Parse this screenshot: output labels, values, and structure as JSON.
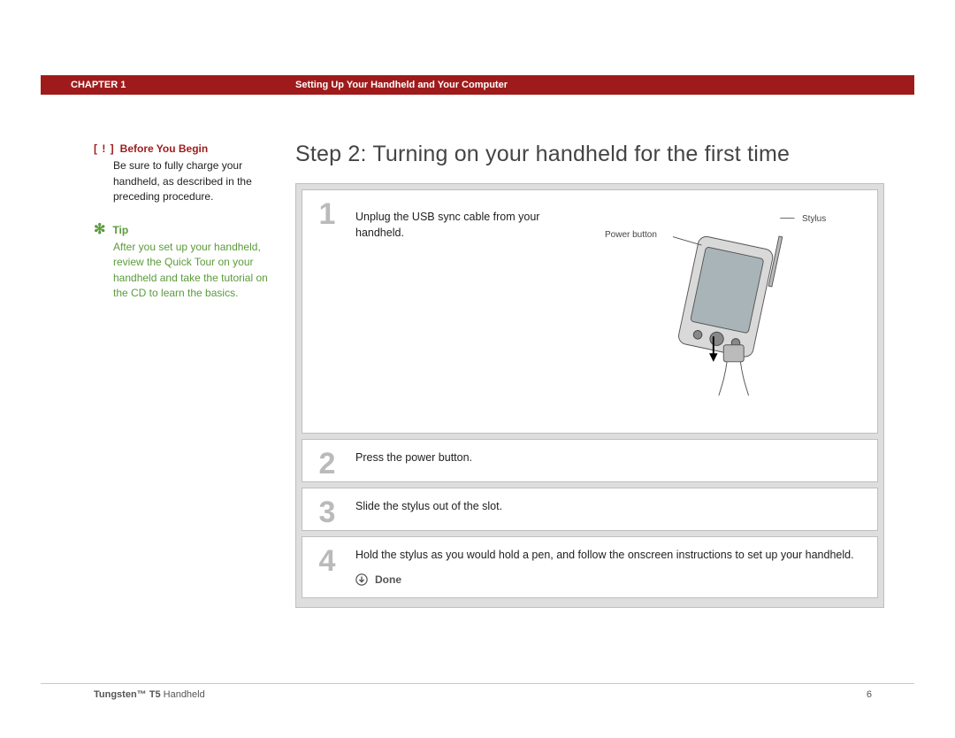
{
  "header": {
    "chapter_label": "CHAPTER 1",
    "section_title": "Setting Up Your Handheld and Your Computer"
  },
  "page_title": "Step 2: Turning on your handheld for the first time",
  "sidebar": {
    "before_you_begin": {
      "icon_text": "[ ! ]",
      "title": "Before You Begin",
      "body": "Be sure to fully charge your handheld, as described in the preceding procedure."
    },
    "tip": {
      "icon": "✻",
      "title": "Tip",
      "body": "After you set up your handheld, review the Quick Tour on your handheld and take the tutorial on the CD to learn the basics."
    }
  },
  "steps": [
    {
      "number": "1",
      "text": "Unplug the USB sync cable from your handheld.",
      "diagram": {
        "label_power_button": "Power button",
        "label_stylus": "Stylus"
      }
    },
    {
      "number": "2",
      "text": "Press the power button."
    },
    {
      "number": "3",
      "text": "Slide the stylus out of the slot."
    },
    {
      "number": "4",
      "text": "Hold the stylus as you would hold a pen, and follow the onscreen instructions to set up your handheld.",
      "done_label": "Done"
    }
  ],
  "footer": {
    "product_bold": "Tungsten™ T5",
    "product_rest": " Handheld",
    "page_number": "6"
  }
}
